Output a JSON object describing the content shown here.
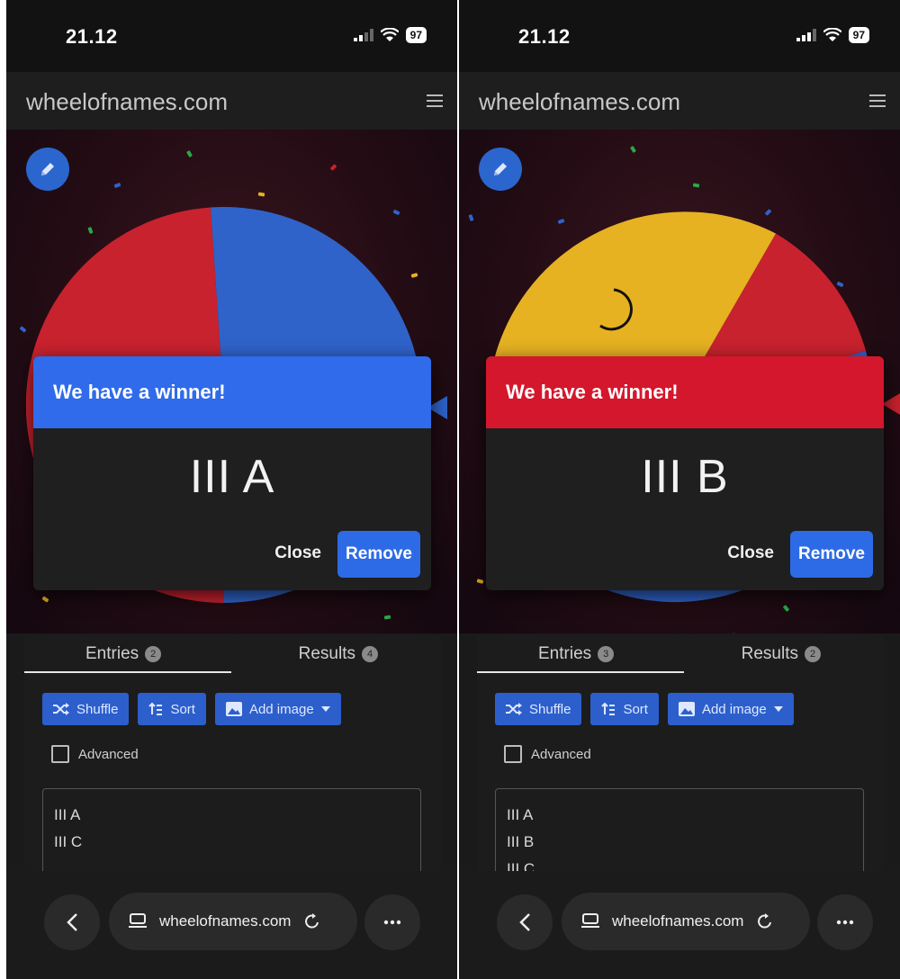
{
  "screens": [
    {
      "status": {
        "time": "21.12",
        "battery": "97"
      },
      "site_title": "wheelofnames.com",
      "wheel": {
        "colors": [
          "#c8222e",
          "#2f63c9"
        ]
      },
      "modal": {
        "header_label": "We have a winner!",
        "header_color": "#2f6bea",
        "winner": "III A",
        "close_label": "Close",
        "remove_label": "Remove"
      },
      "tabs": {
        "entries_label": "Entries",
        "entries_count": "2",
        "results_label": "Results",
        "results_count": "4"
      },
      "toolbar": {
        "shuffle_label": "Shuffle",
        "sort_label": "Sort",
        "add_image_label": "Add image"
      },
      "advanced_label": "Advanced",
      "entries": [
        "III A",
        "III C"
      ],
      "browser": {
        "url": "wheelofnames.com"
      }
    },
    {
      "status": {
        "time": "21.12",
        "battery": "97"
      },
      "site_title": "wheelofnames.com",
      "wheel": {
        "colors": [
          "#e6b222",
          "#c8222e",
          "#2f63c9"
        ]
      },
      "modal": {
        "header_label": "We have a winner!",
        "header_color": "#d4172c",
        "winner": "III B",
        "close_label": "Close",
        "remove_label": "Remove"
      },
      "tabs": {
        "entries_label": "Entries",
        "entries_count": "3",
        "results_label": "Results",
        "results_count": "2"
      },
      "toolbar": {
        "shuffle_label": "Shuffle",
        "sort_label": "Sort",
        "add_image_label": "Add image"
      },
      "advanced_label": "Advanced",
      "entries": [
        "III A",
        "III B",
        "III C"
      ],
      "browser": {
        "url": "wheelofnames.com"
      }
    }
  ]
}
